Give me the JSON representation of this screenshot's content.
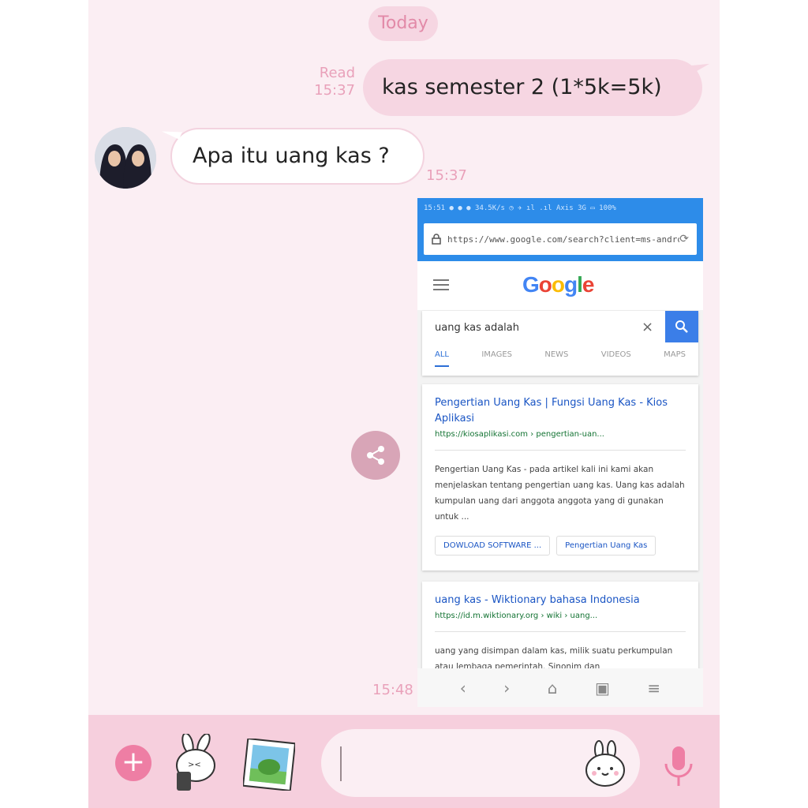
{
  "chat": {
    "date_label": "Today",
    "messages": [
      {
        "direction": "out",
        "text": "kas semester 2 (1*5k=5k)",
        "status": "Read",
        "time": "15:37"
      },
      {
        "direction": "in",
        "text": "Apa itu uang kas ?",
        "time": "15:37"
      },
      {
        "direction": "in",
        "type": "image",
        "time": "15:48"
      }
    ]
  },
  "screenshot": {
    "statusbar_text": "15:51 ● ● ● 34.5K/s ◷ ✈ ıl .ıl Axis 3G ▭ 100%",
    "url": "https://www.google.com/search?client=ms-android",
    "logo": "Google",
    "search_query": "uang kas adalah",
    "tabs": [
      "ALL",
      "IMAGES",
      "NEWS",
      "VIDEOS",
      "MAPS"
    ],
    "results": [
      {
        "title": "Pengertian Uang Kas | Fungsi Uang Kas - Kios Aplikasi",
        "link": "https://kiosaplikasi.com › pengertian-uan...",
        "snippet": "Pengertian Uang Kas - pada artikel kali ini kami akan menjelaskan tentang pengertian uang kas. Uang kas adalah kumpulan uang dari anggota anggota yang di gunakan untuk ...",
        "chips": [
          "DOWLOAD SOFTWARE ...",
          "Pengertian Uang Kas"
        ]
      },
      {
        "title": "uang kas - Wiktionary bahasa Indonesia",
        "link": "https://id.m.wiktionary.org › wiki › uang...",
        "snippet": "uang yang disimpan dalam kas, milik suatu perkumpulan atau lembaga pemerintah. Sinonim dan"
      }
    ]
  },
  "input": {
    "placeholder": ""
  },
  "colors": {
    "background": "#fbeef3",
    "bubble_out": "#f6d6e2",
    "accent": "#ee7ea4",
    "meta_text": "#e9a1ba"
  },
  "icons": [
    "plus-icon",
    "sticker-brown-icon",
    "sticker-frog-icon",
    "emoji-icon",
    "mic-icon",
    "share-icon"
  ]
}
